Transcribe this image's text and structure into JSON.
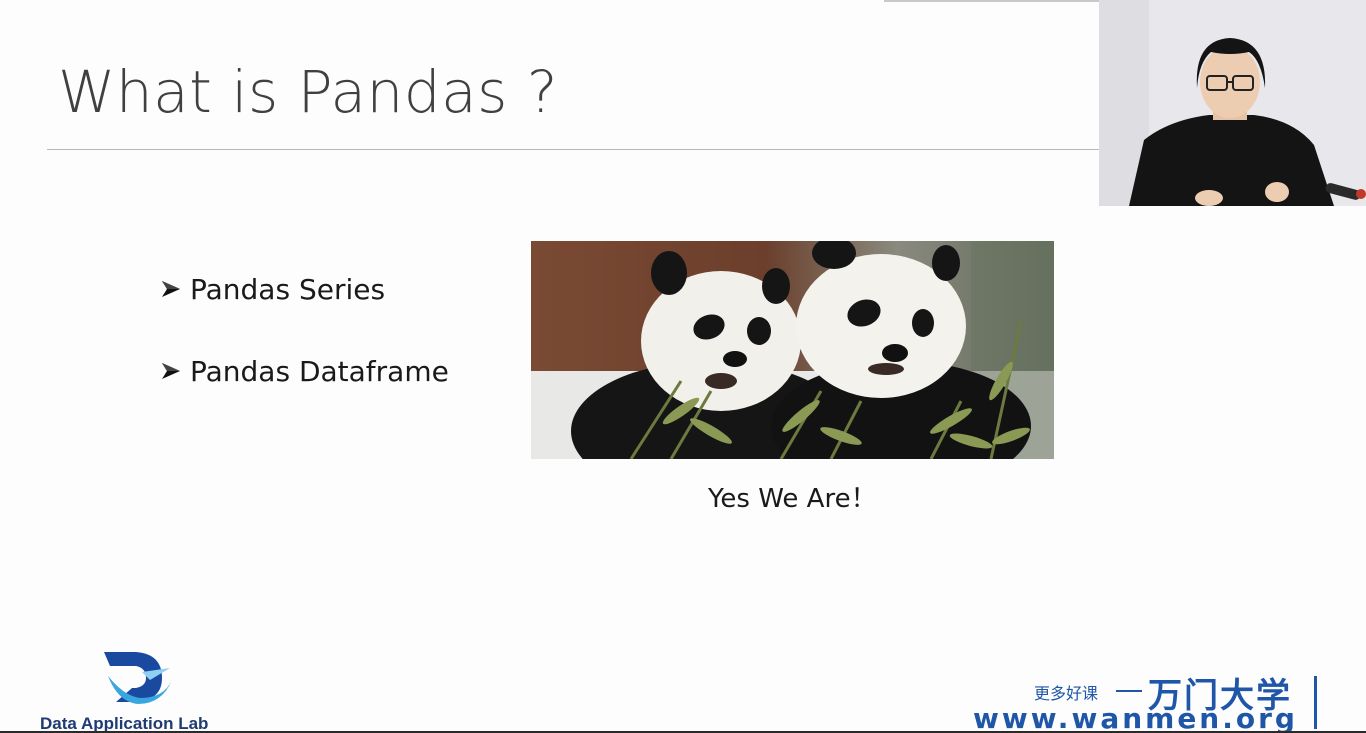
{
  "slide": {
    "title": "What is Pandas ?",
    "bullets": [
      {
        "label": "Pandas Series"
      },
      {
        "label": "Pandas Dataframe"
      }
    ],
    "caption": "Yes We Are！"
  },
  "footer": {
    "logo_text": "Data Application Lab",
    "wanmen_tagline": "更多好课",
    "wanmen_brand": "万门大学",
    "wanmen_url": "www.wanmen.org"
  },
  "icons": {
    "bullet": "arrow-bullet-icon"
  },
  "colors": {
    "title": "#404040",
    "brand_blue": "#1f56a8",
    "dal_navy": "#1f3b73"
  }
}
